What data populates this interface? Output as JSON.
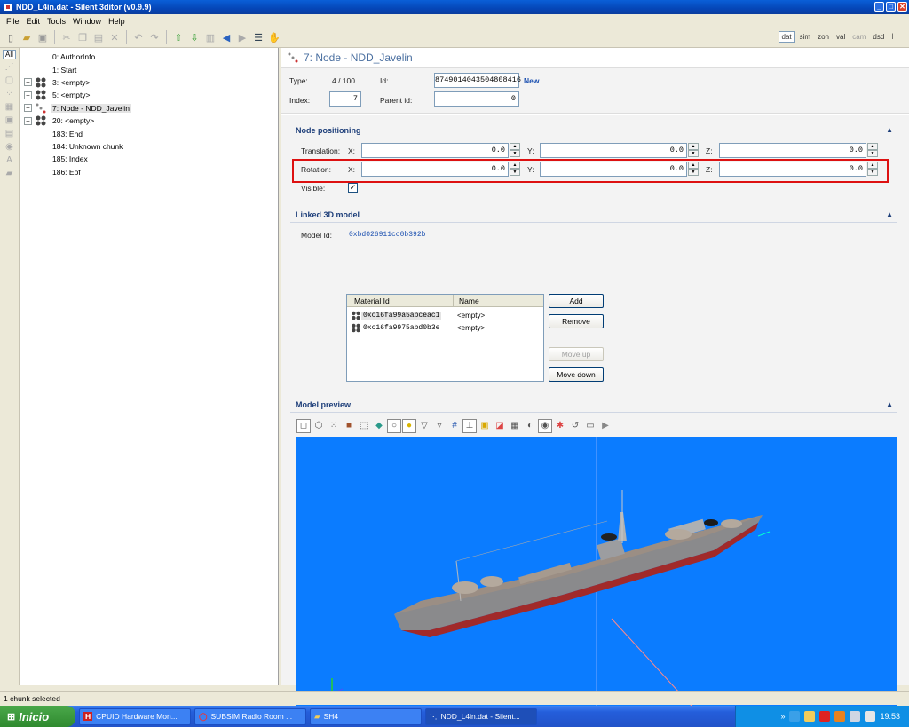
{
  "window": {
    "title": "NDD_L4in.dat - Silent 3ditor (v0.9.9)",
    "minimize": "_",
    "maximize": "□",
    "close": "✕"
  },
  "menu": [
    "File",
    "Edit",
    "Tools",
    "Window",
    "Help"
  ],
  "toolbar": {
    "right_modes": [
      "dat",
      "sim",
      "zon",
      "val",
      "cam",
      "dsd"
    ]
  },
  "leftstrip": {
    "all_label": "All"
  },
  "tree": [
    {
      "label": "0: AuthorInfo",
      "expandable": false,
      "icon": "none"
    },
    {
      "label": "1: Start",
      "expandable": false,
      "icon": "none"
    },
    {
      "label": "3: <empty>",
      "expandable": true,
      "icon": "spheres"
    },
    {
      "label": "5: <empty>",
      "expandable": true,
      "icon": "spheres"
    },
    {
      "label": "7: Node - NDD_Javelin",
      "expandable": true,
      "icon": "node",
      "selected": true
    },
    {
      "label": "20: <empty>",
      "expandable": true,
      "icon": "spheres"
    },
    {
      "label": "183: End",
      "expandable": false,
      "icon": "none"
    },
    {
      "label": "184: Unknown chunk",
      "expandable": false,
      "icon": "none"
    },
    {
      "label": "185: Index",
      "expandable": false,
      "icon": "none"
    },
    {
      "label": "186: Eof",
      "expandable": false,
      "icon": "none"
    }
  ],
  "panel": {
    "title": "7: Node - NDD_Javelin",
    "type_label": "Type:",
    "type_value": "4 / 100",
    "id_label": "Id:",
    "id_value": "8749014043504808416",
    "new_link": "New",
    "index_label": "Index:",
    "index_value": "7",
    "parent_label": "Parent id:",
    "parent_value": "0"
  },
  "positioning": {
    "title": "Node positioning",
    "translation_label": "Translation:",
    "rotation_label": "Rotation:",
    "x_label": "X:",
    "y_label": "Y:",
    "z_label": "Z:",
    "translation": {
      "x": "0.0",
      "y": "0.0",
      "z": "0.0"
    },
    "rotation": {
      "x": "0.0",
      "y": "0.0",
      "z": "0.0"
    },
    "visible_label": "Visible:",
    "visible_check": "✓",
    "highlight_color": "#dd1111"
  },
  "linked": {
    "title": "Linked 3D model",
    "model_id_label": "Model Id:",
    "model_id": "0xbd026911cc0b392b",
    "columns": [
      "Material Id",
      "Name"
    ],
    "rows": [
      {
        "id": "0xc16fa99a5abceac1",
        "name": "<empty>",
        "selected": true
      },
      {
        "id": "0xc16fa9975abd0b3e",
        "name": "<empty>"
      }
    ],
    "buttons": {
      "add": "Add",
      "remove": "Remove",
      "move_up": "Move up",
      "move_down": "Move down"
    }
  },
  "preview": {
    "title": "Model preview",
    "background": "#0b7cff"
  },
  "status": {
    "text": "1 chunk selected"
  },
  "taskbar": {
    "start": "Inicio",
    "tasks": [
      "CPUID Hardware Mon...",
      "SUBSIM Radio Room ...",
      "SH4",
      "NDD_L4in.dat - Silent..."
    ],
    "clock": "19:53",
    "chevron": "»"
  }
}
